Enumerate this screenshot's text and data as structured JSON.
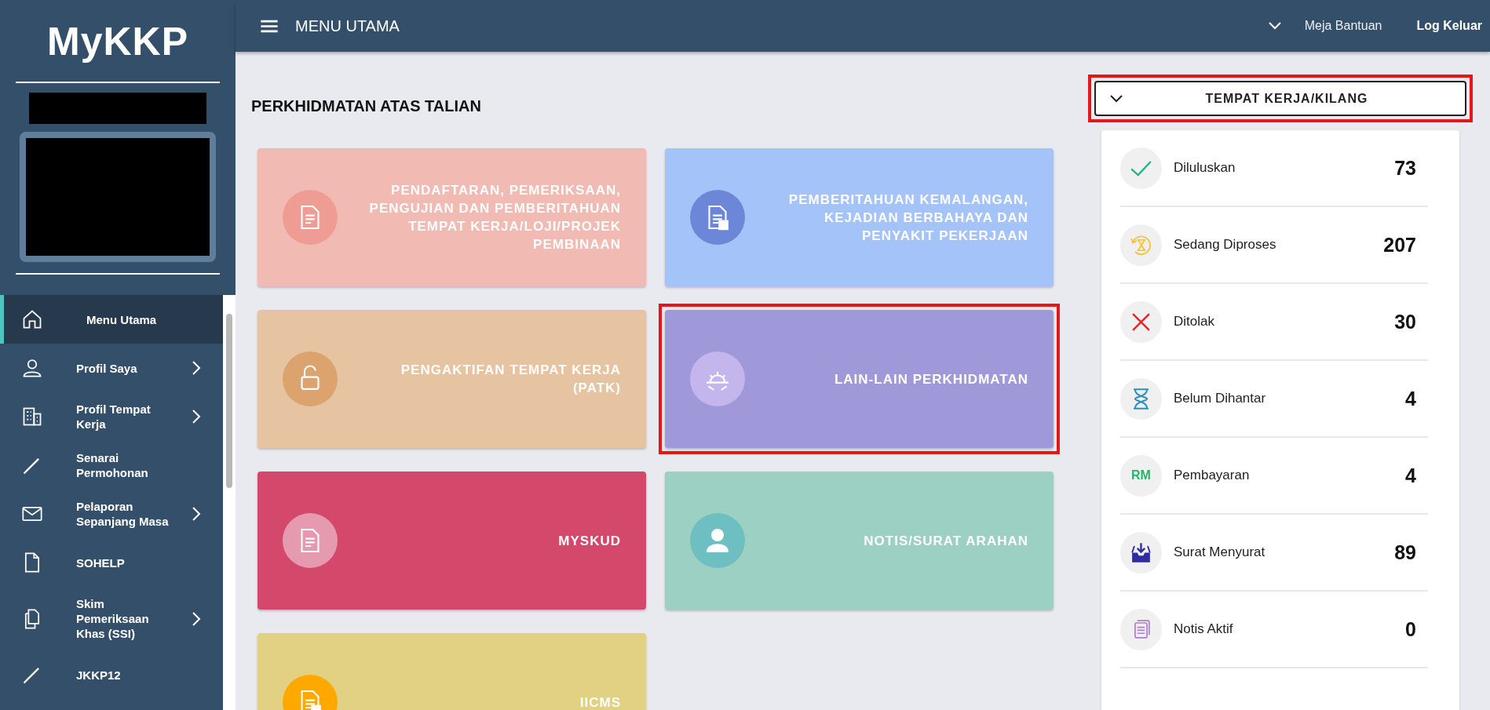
{
  "sidebar": {
    "logo": "MyKKP",
    "items": [
      {
        "label": "Menu Utama",
        "selected": true,
        "has_submenu": false
      },
      {
        "label": "Profil Saya",
        "selected": false,
        "has_submenu": true
      },
      {
        "label": "Profil Tempat Kerja",
        "selected": false,
        "has_submenu": true
      },
      {
        "label": "Senarai Permohonan",
        "selected": false,
        "has_submenu": false
      },
      {
        "label": "Pelaporan Sepanjang Masa",
        "selected": false,
        "has_submenu": true
      },
      {
        "label": "SOHELP",
        "selected": false,
        "has_submenu": false
      },
      {
        "label": "Skim Pemeriksaan Khas (SSI)",
        "selected": false,
        "has_submenu": true
      },
      {
        "label": "JKKP12",
        "selected": false,
        "has_submenu": false
      }
    ]
  },
  "topbar": {
    "title": "MENU UTAMA",
    "links": [
      "Meja Bantuan",
      "Log Keluar"
    ]
  },
  "main": {
    "heading": "PERKHIDMATAN ATAS TALIAN",
    "cards": [
      {
        "title": "PENDAFTARAN, PEMERIKSAAN, PENGUJIAN DAN PEMBERITAHUAN TEMPAT KERJA/LOJI/PROJEK PEMBINAAN",
        "color": "#f1bab2",
        "highlighted": false
      },
      {
        "title": "PEMBERITAHUAN KEMALANGAN, KEJADIAN BERBAHAYA DAN PENYAKIT PEKERJAAN",
        "color": "#a3c3f9",
        "highlighted": false
      },
      {
        "title": "PENGAKTIFAN TEMPAT KERJA (PATK)",
        "color": "#e6c4a2",
        "highlighted": false
      },
      {
        "title": "LAIN-LAIN PERKHIDMATAN",
        "color": "#9f98d9",
        "highlighted": true
      },
      {
        "title": "MYSKUD",
        "color": "#d4486b",
        "highlighted": false
      },
      {
        "title": "NOTIS/SURAT ARAHAN",
        "color": "#9bd0c3",
        "highlighted": false
      },
      {
        "title": "IICMS",
        "color": "#e2d083",
        "highlighted": false
      }
    ]
  },
  "side": {
    "dropdown": {
      "label": "TEMPAT KERJA/KILANG",
      "highlighted": true
    },
    "stats": [
      {
        "label": "Diluluskan",
        "count": "73"
      },
      {
        "label": "Sedang Diproses",
        "count": "207"
      },
      {
        "label": "Ditolak",
        "count": "30"
      },
      {
        "label": "Belum Dihantar",
        "count": "4"
      },
      {
        "label": "Pembayaran",
        "count": "4",
        "icon_text": "RM"
      },
      {
        "label": "Surat Menyurat",
        "count": "89"
      },
      {
        "label": "Notis Aktif",
        "count": "0"
      }
    ]
  }
}
